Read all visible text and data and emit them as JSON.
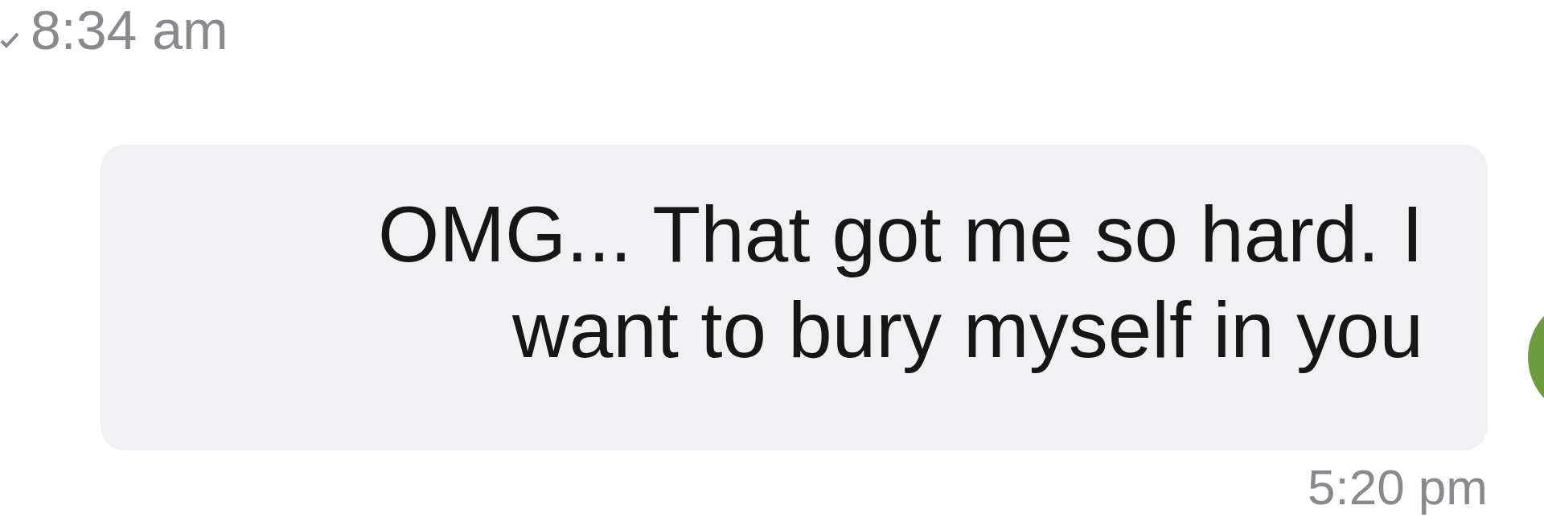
{
  "previous_message": {
    "time": "8:34 am",
    "read": true
  },
  "message": {
    "text": "OMG... That got me so hard. I want to bury myself in you",
    "time": "5:20 pm"
  }
}
